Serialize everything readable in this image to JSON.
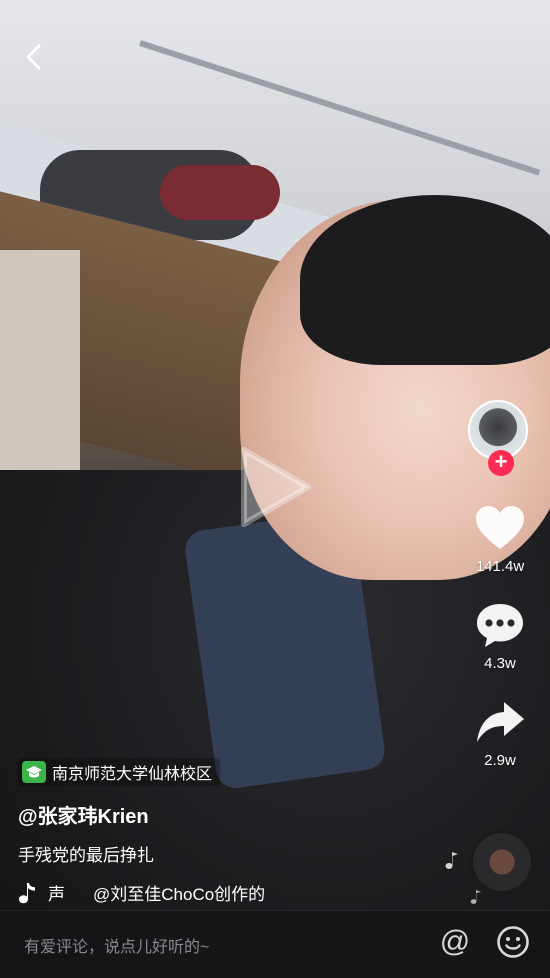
{
  "location": {
    "label": "南京师范大学仙林校区"
  },
  "author": {
    "handle": "@张家玮Krien"
  },
  "caption": "手残党的最后挣扎",
  "music": {
    "label": "声",
    "credit": "@刘至佳ChoCo创作的"
  },
  "stats": {
    "likes": "141.4w",
    "comments": "4.3w",
    "shares": "2.9w"
  },
  "follow_symbol": "+",
  "comment_bar": {
    "placeholder": "有爱评论，说点儿好听的~",
    "at_symbol": "@"
  },
  "icons": [
    "back-icon",
    "play-icon",
    "heart-icon",
    "comment-icon",
    "share-icon",
    "music-note-icon",
    "emoji-icon",
    "graduation-cap-icon"
  ],
  "colors": {
    "follow": "#fe2c55",
    "location_badge": "#3bb54a"
  }
}
